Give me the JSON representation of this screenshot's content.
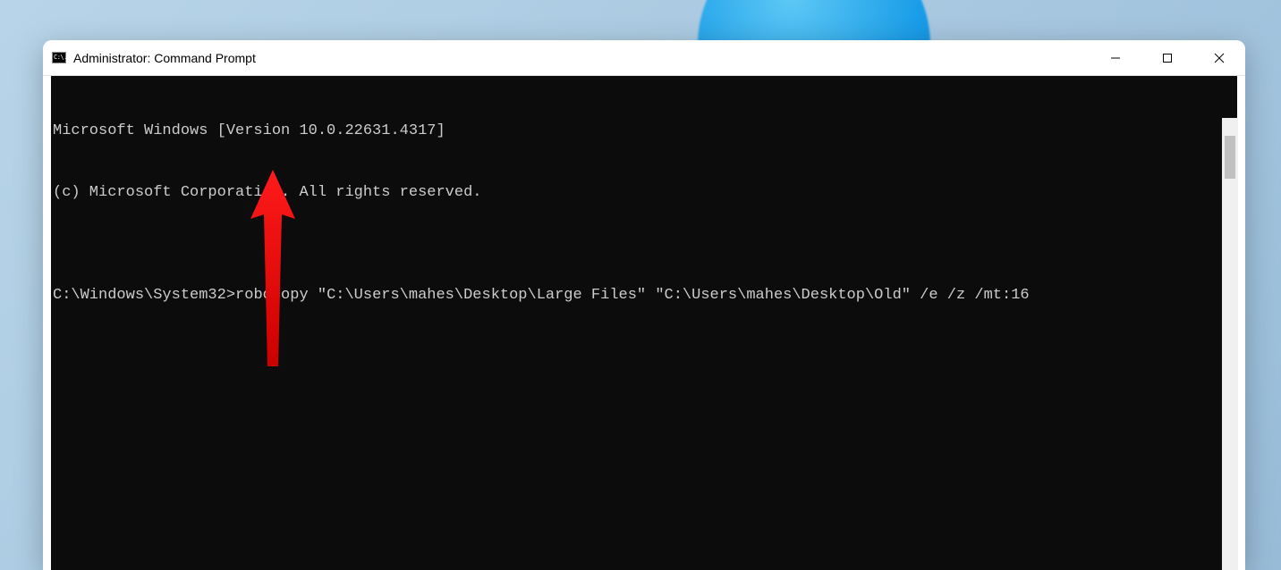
{
  "window": {
    "title": "Administrator: Command Prompt"
  },
  "terminal": {
    "line1": "Microsoft Windows [Version 10.0.22631.4317]",
    "line2": "(c) Microsoft Corporation. All rights reserved.",
    "blank": "",
    "prompt": "C:\\Windows\\System32>",
    "command": "robocopy \"C:\\Users\\mahes\\Desktop\\Large Files\" \"C:\\Users\\mahes\\Desktop\\Old\" /e /z /mt:16"
  },
  "icon_glyph": "C:\\."
}
